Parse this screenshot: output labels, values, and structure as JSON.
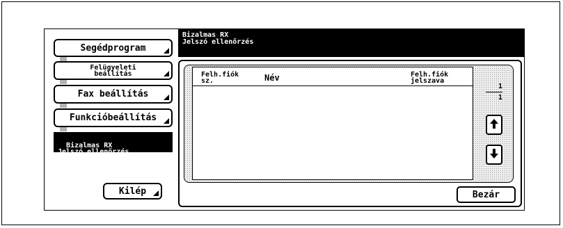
{
  "sidebar": {
    "items": [
      {
        "label": "Segédprogram"
      },
      {
        "label": "Felügyeleti\nbeállítás"
      },
      {
        "label": "Fax beállítás"
      },
      {
        "label": "Funkcióbeállítás"
      },
      {
        "label": "Bizalmas RX\nJelszó ellenőrzés"
      }
    ],
    "exit_label": "Kilép"
  },
  "header": {
    "title": "Bizalmas RX\nJelszó ellenőrzés"
  },
  "table": {
    "columns": [
      "Felh.fiók\nsz.",
      "Név",
      "Felh.fiók\njelszava"
    ],
    "rows": []
  },
  "pager": {
    "current": "1",
    "total": "1"
  },
  "footer": {
    "close_label": "Bezár"
  }
}
